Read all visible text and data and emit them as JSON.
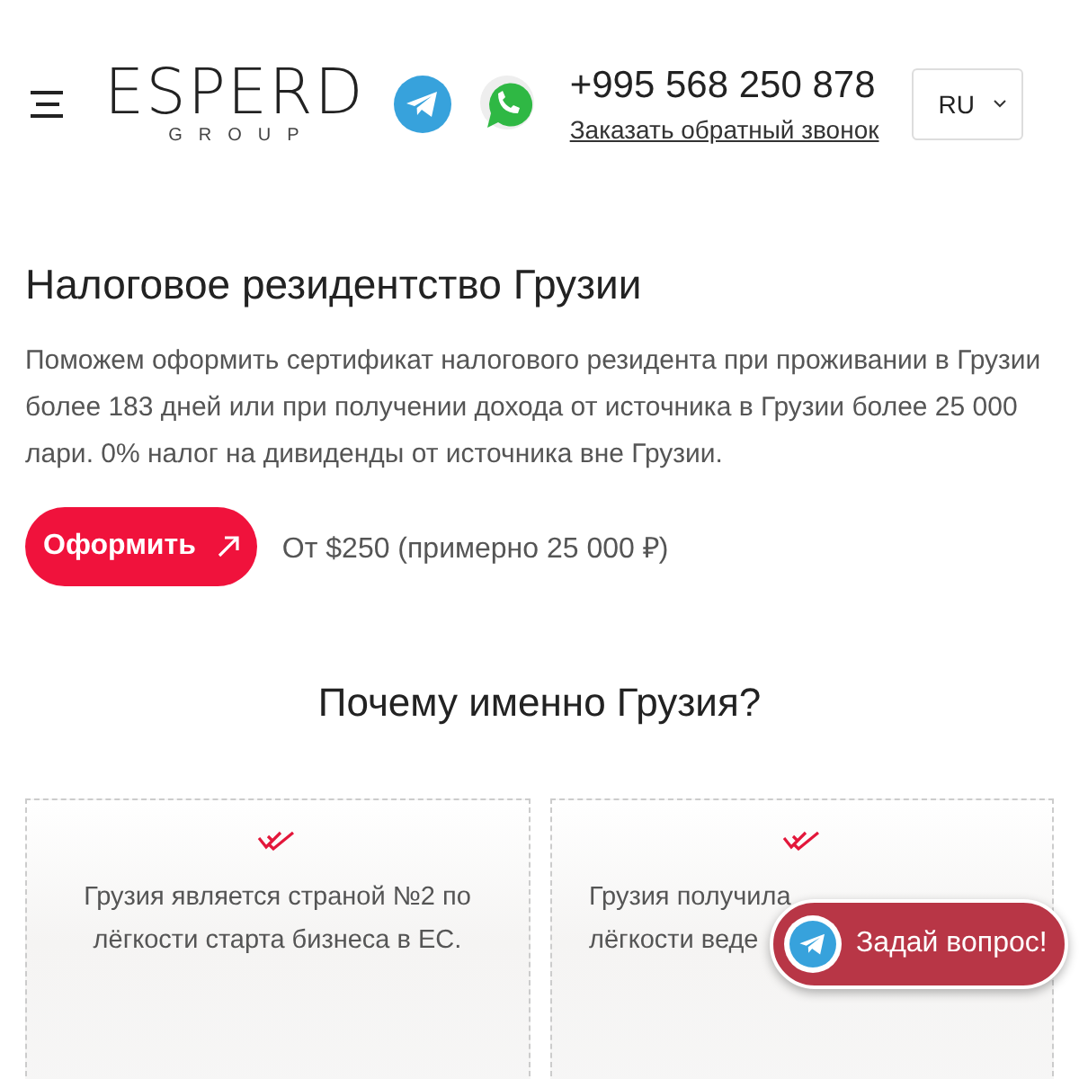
{
  "header": {
    "logo": {
      "name": "ESPERD",
      "sub": "GROUP"
    },
    "phone": "+995 568 250 878",
    "callback_link": "Заказать обратный звонок",
    "language": "RU"
  },
  "hero": {
    "title": "Налоговое резидентство Грузии",
    "text": "Поможем оформить сертификат налогового резидента при проживании в Грузии более 183 дней или при получении дохода от источника в Грузии более 25 000 лари. 0% налог на дивиденды от источника вне Грузии.",
    "button": "Оформить",
    "price": "От $250 (примерно 25 000 ₽)"
  },
  "why": {
    "title": "Почему именно Грузия?",
    "cards": [
      {
        "text": "Грузия является страной №2 по\nлёгкости старта бизнеса в ЕС."
      },
      {
        "text": "Грузия получила\nлёгкости веде"
      }
    ]
  },
  "chat_button": "Задай вопрос!"
}
